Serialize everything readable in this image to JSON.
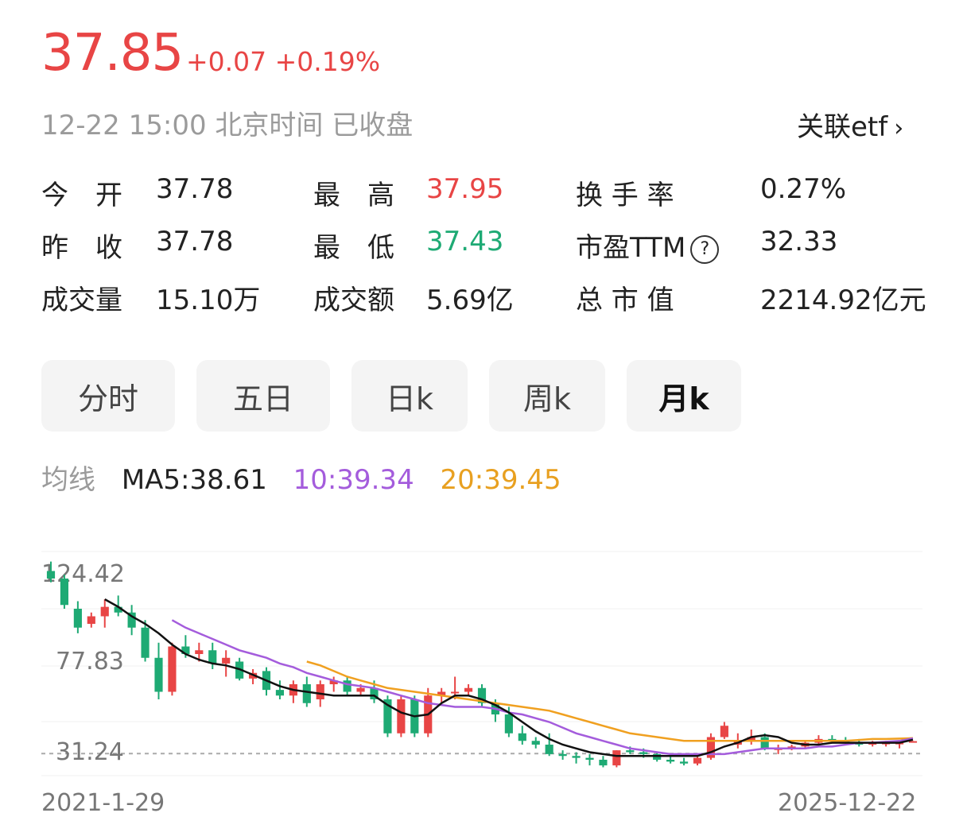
{
  "quote": {
    "price": "37.85",
    "change": "+0.07",
    "change_pct": "+0.19%",
    "time": "12-22 15:00 北京时间 已收盘",
    "related_etf": "关联etf",
    "chevron": "›"
  },
  "stats": [
    {
      "label": "今　开",
      "value": "37.78",
      "color": ""
    },
    {
      "label": "最　高",
      "value": "37.95",
      "color": "red"
    },
    {
      "label": "换 手 率",
      "value": "0.27%",
      "color": ""
    },
    {
      "label": "昨　收",
      "value": "37.78",
      "color": ""
    },
    {
      "label": "最　低",
      "value": "37.43",
      "color": "green"
    },
    {
      "label": "市盈TTM",
      "value": "32.33",
      "color": "",
      "help": "?"
    },
    {
      "label": "成交量",
      "value": "15.10万",
      "color": ""
    },
    {
      "label": "成交额",
      "value": "5.69亿",
      "color": ""
    },
    {
      "label": "总 市 值",
      "value": "2214.92亿元",
      "color": ""
    }
  ],
  "tabs": [
    {
      "label": "分时",
      "active": false
    },
    {
      "label": "五日",
      "active": false
    },
    {
      "label": "日k",
      "active": false
    },
    {
      "label": "周k",
      "active": false
    },
    {
      "label": "月k",
      "active": true
    }
  ],
  "ma": {
    "label": "均线",
    "ma5": "MA5:38.61",
    "ma10": "10:39.34",
    "ma20": "20:39.45"
  },
  "colors": {
    "up": "#e84545",
    "down": "#1eaa74",
    "ma5": "#111111",
    "ma10": "#a45cdc",
    "ma20": "#f0a020"
  },
  "chart_data": {
    "type": "candlestick",
    "y_labels": [
      "124.42",
      "77.83",
      "31.24"
    ],
    "x_labels": [
      "2021-1-29",
      "2025-12-22"
    ],
    "ylim": [
      20,
      140
    ],
    "reference_line": 31.24,
    "ohlc": [
      [
        128,
        133,
        122,
        124
      ],
      [
        124,
        126,
        108,
        110
      ],
      [
        108,
        112,
        95,
        98
      ],
      [
        100,
        106,
        98,
        104
      ],
      [
        104,
        113,
        98,
        109
      ],
      [
        109,
        115,
        104,
        106
      ],
      [
        106,
        110,
        94,
        98
      ],
      [
        98,
        102,
        80,
        82
      ],
      [
        82,
        90,
        60,
        64
      ],
      [
        64,
        90,
        62,
        88
      ],
      [
        88,
        94,
        82,
        84
      ],
      [
        84,
        90,
        80,
        86
      ],
      [
        86,
        90,
        76,
        79
      ],
      [
        79,
        86,
        72,
        82
      ],
      [
        80,
        82,
        70,
        71
      ],
      [
        71,
        76,
        68,
        74
      ],
      [
        75,
        77,
        62,
        65
      ],
      [
        65,
        70,
        60,
        62
      ],
      [
        62,
        70,
        58,
        68
      ],
      [
        68,
        72,
        56,
        58
      ],
      [
        60,
        70,
        56,
        68
      ],
      [
        68,
        72,
        64,
        70
      ],
      [
        70,
        72,
        62,
        64
      ],
      [
        64,
        68,
        62,
        66
      ],
      [
        66,
        70,
        58,
        60
      ],
      [
        60,
        62,
        40,
        42
      ],
      [
        42,
        62,
        40,
        60
      ],
      [
        60,
        62,
        40,
        42
      ],
      [
        42,
        66,
        40,
        62
      ],
      [
        62,
        66,
        58,
        64
      ],
      [
        64,
        72,
        60,
        64
      ],
      [
        64,
        68,
        62,
        66
      ],
      [
        66,
        68,
        56,
        58
      ],
      [
        58,
        60,
        48,
        52
      ],
      [
        52,
        56,
        40,
        42
      ],
      [
        42,
        46,
        36,
        38
      ],
      [
        38,
        40,
        34,
        36
      ],
      [
        36,
        42,
        30,
        31
      ],
      [
        31,
        33,
        28,
        30
      ],
      [
        30,
        32,
        26,
        29
      ],
      [
        29,
        31,
        25,
        28
      ],
      [
        28,
        30,
        24,
        25
      ],
      [
        25,
        33,
        24,
        33
      ],
      [
        33,
        35,
        31,
        32
      ],
      [
        32,
        34,
        29,
        31
      ],
      [
        31,
        32,
        27,
        28
      ],
      [
        28,
        30,
        26,
        27
      ],
      [
        27,
        29,
        25,
        26
      ],
      [
        26,
        30,
        25,
        29
      ],
      [
        29,
        42,
        28,
        40
      ],
      [
        40,
        48,
        39,
        46
      ],
      [
        36,
        42,
        34,
        38
      ],
      [
        38,
        44,
        36,
        40
      ],
      [
        40,
        42,
        33,
        34
      ],
      [
        34,
        36,
        31,
        34
      ],
      [
        34,
        36,
        33,
        35
      ],
      [
        35,
        38,
        34,
        37
      ],
      [
        37,
        41,
        36,
        39
      ],
      [
        39,
        41,
        37,
        38
      ],
      [
        38,
        40,
        36,
        37
      ],
      [
        37,
        39,
        35,
        36
      ],
      [
        36,
        38,
        35,
        37
      ],
      [
        37,
        38,
        35,
        37
      ],
      [
        37,
        38,
        34,
        37
      ],
      [
        37.78,
        37.95,
        37.43,
        37.85
      ]
    ],
    "ma5": [
      null,
      null,
      null,
      null,
      113,
      109,
      104,
      100,
      95,
      89,
      84,
      81,
      79,
      78,
      76,
      73,
      70,
      67,
      65,
      64,
      63,
      62,
      62,
      62,
      62,
      57,
      53,
      51,
      52,
      58,
      62,
      62,
      60,
      57,
      53,
      48,
      43,
      39,
      36,
      34,
      32,
      31,
      30,
      30,
      30,
      30,
      30,
      30,
      30,
      32,
      35,
      37,
      40,
      41,
      40,
      37,
      36,
      36,
      37,
      37,
      37,
      37,
      37,
      37,
      38.61
    ],
    "ma10": [
      null,
      null,
      null,
      null,
      null,
      null,
      null,
      null,
      null,
      102,
      98,
      95,
      92,
      89,
      86,
      84,
      82,
      79,
      77,
      74,
      72,
      70,
      68,
      67,
      66,
      64,
      62,
      60,
      58,
      57,
      56,
      56,
      56,
      55,
      53,
      52,
      50,
      48,
      45,
      42,
      40,
      38,
      36,
      34,
      33,
      32,
      31,
      31,
      31,
      31,
      31,
      32,
      33,
      34,
      34,
      34,
      34,
      35,
      35,
      36,
      37,
      37,
      37.5,
      38,
      39.34
    ],
    "ma20": [
      null,
      null,
      null,
      null,
      null,
      null,
      null,
      null,
      null,
      null,
      null,
      null,
      null,
      null,
      null,
      null,
      null,
      null,
      null,
      80,
      78,
      75,
      72,
      70,
      68,
      66,
      65,
      64,
      63,
      62,
      61,
      60,
      59,
      58,
      57,
      56,
      55,
      54,
      52,
      50,
      48,
      46,
      44,
      42,
      41,
      40,
      39,
      38,
      38,
      38,
      38,
      38,
      38,
      38,
      38,
      38,
      38,
      38,
      38,
      38,
      38.5,
      39,
      39,
      39.2,
      39.45
    ]
  }
}
